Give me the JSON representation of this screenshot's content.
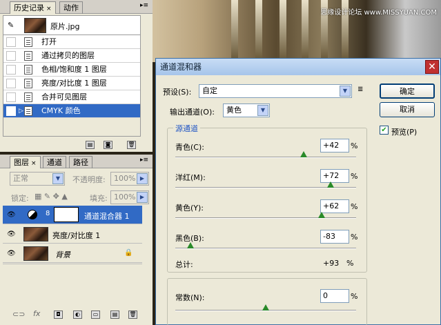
{
  "history_panel": {
    "tabs": [
      "历史记录",
      "动作"
    ],
    "snapshot_label": "原片.jpg",
    "steps": [
      "打开",
      "通过拷贝的图层",
      "色相/饱和度 1 图层",
      "亮度/对比度 1 图层",
      "合并可见图层",
      "CMYK 颜色"
    ],
    "selected_step": "CMYK 颜色"
  },
  "layers_panel": {
    "tabs": [
      "图层",
      "通道",
      "路径"
    ],
    "blend_mode": "正常",
    "opacity_label": "不透明度:",
    "opacity_value": "100%",
    "lock_label": "锁定:",
    "fill_label": "填充:",
    "fill_value": "100%",
    "layers": [
      "通道混合器 1",
      "亮度/对比度 1",
      "背景"
    ]
  },
  "channel_mixer_dialog": {
    "title": "通道混和器",
    "preset_label": "预设(S):",
    "preset_value": "自定",
    "output_label": "输出通道(O):",
    "output_value": "黄色",
    "group_label": "源通道",
    "sliders": [
      {
        "label": "青色(C):",
        "value": "+42",
        "unit": "%",
        "level": 0.71
      },
      {
        "label": "洋红(M):",
        "value": "+72",
        "unit": "%",
        "level": 0.86
      },
      {
        "label": "黄色(Y):",
        "value": "+62",
        "unit": "%",
        "level": 0.81
      },
      {
        "label": "黑色(B):",
        "value": "-83",
        "unit": "%",
        "level": 0.085
      }
    ],
    "total_label": "总计:",
    "total_value": "+93",
    "total_unit": "%",
    "constant_label": "常数(N):",
    "constant_value": "0",
    "constant_unit": "%",
    "constant_level": 0.5,
    "ok_label": "确定",
    "cancel_label": "取消",
    "preview_label": "预览(P)"
  },
  "watermark": "思缘设计论坛 www.MISSYUAN.COM"
}
